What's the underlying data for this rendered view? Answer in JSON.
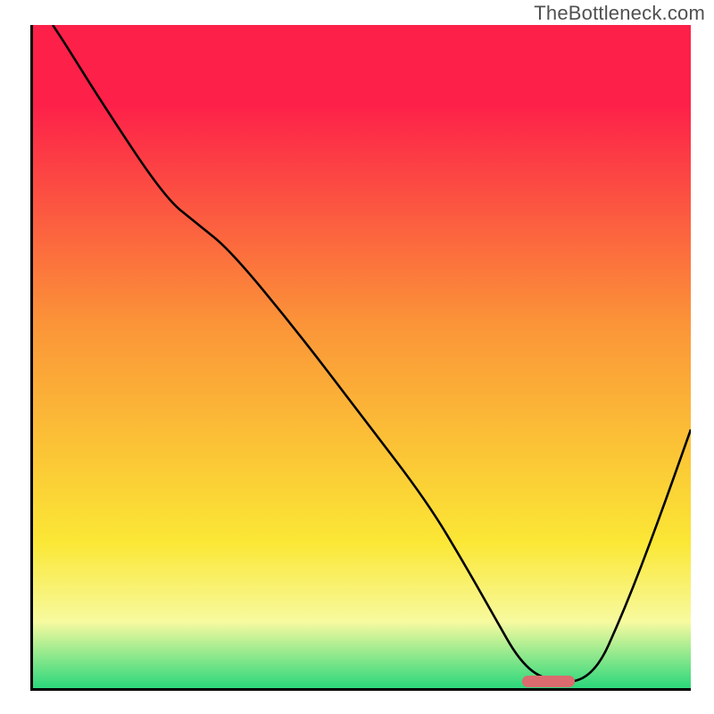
{
  "watermark": "TheBottleneck.com",
  "colors": {
    "grad_top_red": "#fd2049",
    "grad_orange": "#fb9438",
    "grad_yellow": "#fbe735",
    "grad_pale": "#f7fa9f",
    "grad_green": "#2bd77b",
    "curve": "#000000",
    "marker": "#db6b6e"
  },
  "chart_data": {
    "type": "line",
    "title": "",
    "xlabel": "",
    "ylabel": "",
    "xlim": [
      0,
      100
    ],
    "ylim": [
      0,
      100
    ],
    "x": [
      3,
      5,
      10,
      20,
      25,
      30,
      40,
      50,
      60,
      66,
      70,
      74,
      78,
      85,
      90,
      95,
      100
    ],
    "values": [
      100,
      97,
      89,
      74,
      70,
      66,
      54,
      41,
      28,
      18,
      11,
      4,
      1.0,
      1.0,
      12,
      25,
      39
    ],
    "marker_x_range_pct": [
      74,
      82
    ],
    "gradient_stops_pct": {
      "red": 0,
      "red2": 12,
      "orange": 45,
      "yellow": 78,
      "pale": 90,
      "green": 100
    }
  }
}
